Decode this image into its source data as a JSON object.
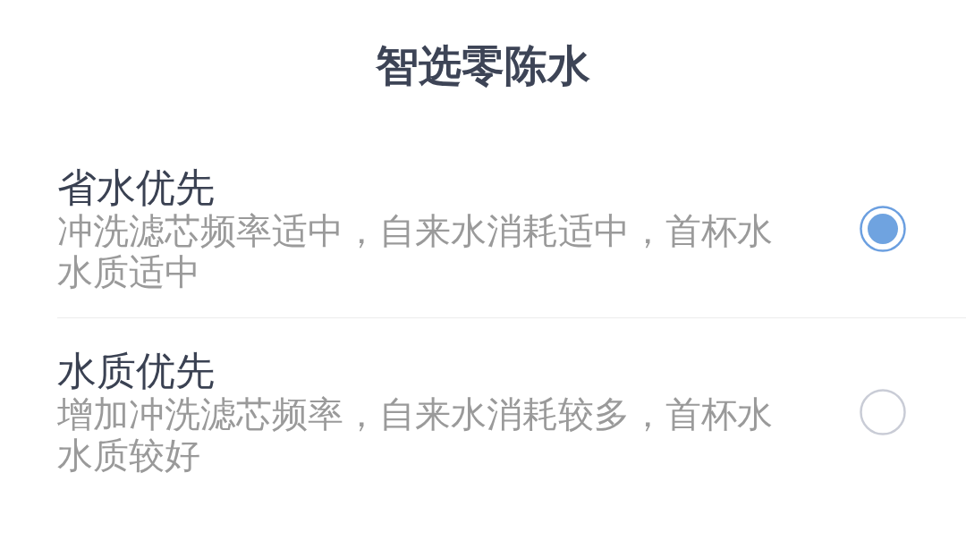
{
  "title": "智选零陈水",
  "options": [
    {
      "label": "省水优先",
      "description": "冲洗滤芯频率适中，自来水消耗适中，首杯水水质适中",
      "selected": true
    },
    {
      "label": "水质优先",
      "description": "增加冲洗滤芯频率，自来水消耗较多，首杯水水质较好",
      "selected": false
    }
  ]
}
